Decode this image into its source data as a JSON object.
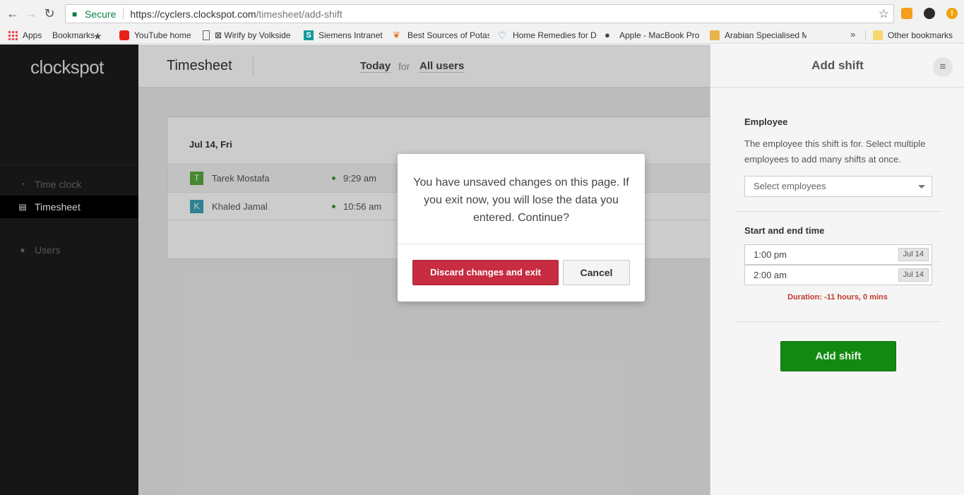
{
  "browser": {
    "secure_label": "Secure",
    "url_host": "https://cyclers.clockspot.com",
    "url_path": "/timesheet/add-shift"
  },
  "bookmarks": {
    "items": [
      {
        "label": "Apps",
        "icon": "apps-icon"
      },
      {
        "label": "Bookmarks",
        "icon": "star-icon"
      },
      {
        "label": "YouTube home",
        "icon": "youtube-icon"
      },
      {
        "label": "⊠ Wirify by Volkside",
        "icon": "page-icon"
      },
      {
        "label": "Siemens Intranet",
        "icon": "siemens-icon"
      },
      {
        "label": "Best Sources of Potas",
        "icon": "potassium-icon"
      },
      {
        "label": "Home Remedies for D",
        "icon": "heart-icon"
      },
      {
        "label": "Apple - MacBook Pro",
        "icon": "apple-icon"
      },
      {
        "label": "Arabian Specialised M",
        "icon": "arabian-icon"
      }
    ],
    "more": "»",
    "other": "Other bookmarks"
  },
  "sidebar": {
    "logo": "clockspot",
    "items": [
      {
        "label": "Time clock",
        "icon": "clock-icon"
      },
      {
        "label": "Timesheet",
        "icon": "clipboard-icon"
      },
      {
        "label": "Users",
        "icon": "users-icon"
      }
    ]
  },
  "header": {
    "title": "Timesheet",
    "range": "Today",
    "for": "for",
    "scope": "All users"
  },
  "timesheet": {
    "date": "Jul 14, Fri",
    "rows": [
      {
        "initial": "T",
        "name": "Tarek Mostafa",
        "time": "9:29 am",
        "color": "#5aab3c"
      },
      {
        "initial": "K",
        "name": "Khaled Jamal",
        "time": "10:56 am",
        "color": "#3ba3b8"
      }
    ]
  },
  "panel": {
    "title": "Add shift",
    "employee_label": "Employee",
    "employee_help": "The employee this shift is for. Select multiple employees to add many shifts at once.",
    "employee_placeholder": "Select employees",
    "time_label": "Start and end time",
    "start_time": "1:00 pm",
    "start_date": "Jul 14",
    "end_time": "2:00 am",
    "end_date": "Jul 14",
    "duration": "Duration: -11 hours, 0 mins",
    "submit_label": "Add shift"
  },
  "modal": {
    "message": "You have unsaved changes on this page. If you exit now, you will lose the data you entered. Continue?",
    "discard_label": "Discard changes and exit",
    "cancel_label": "Cancel"
  },
  "colors": {
    "accent_green": "#128a12",
    "danger_red": "#c72c41",
    "sidebar_bg": "#1c1c1c"
  }
}
